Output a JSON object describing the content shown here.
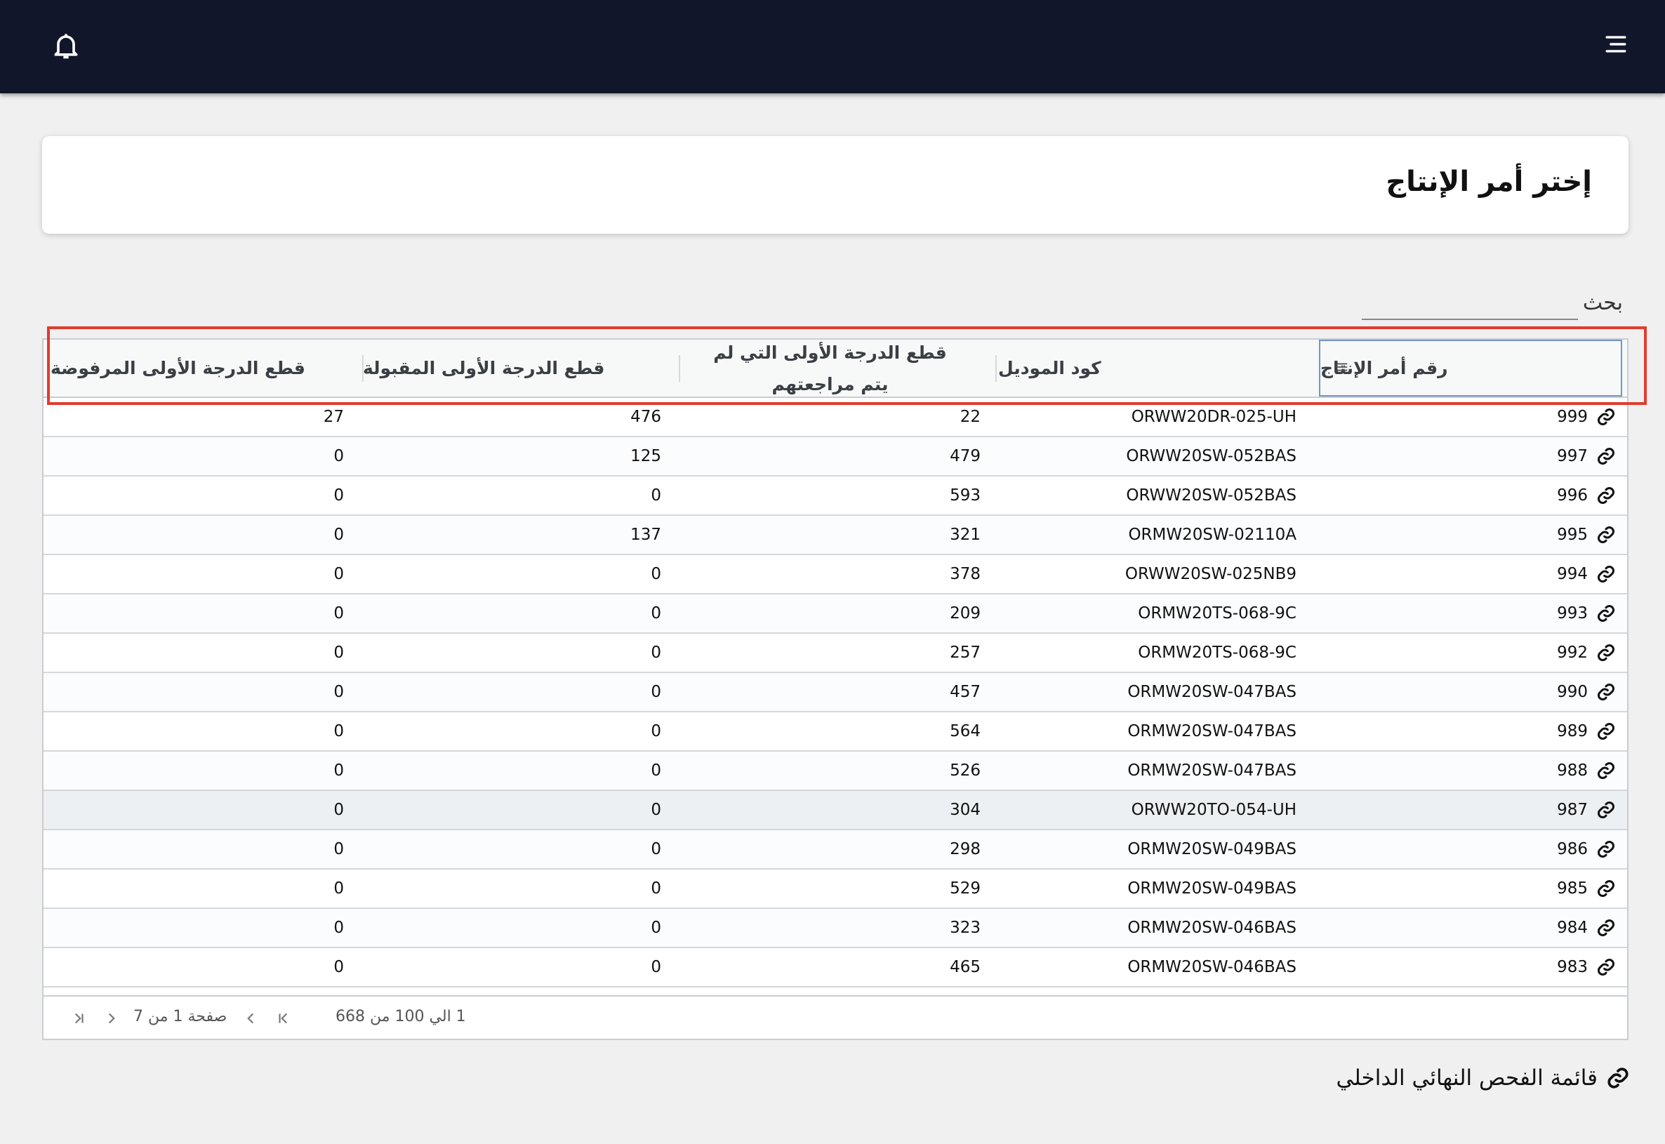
{
  "header": {
    "notifications_icon": "bell-icon",
    "menu_icon": "hamburger-menu-icon"
  },
  "page": {
    "title": "إختر أمر الإنتاج"
  },
  "search": {
    "label": "بحث",
    "value": "",
    "placeholder": ""
  },
  "table": {
    "columns": [
      {
        "label": "رقم أمر الإنتاج"
      },
      {
        "label": "كود الموديل"
      },
      {
        "label": "قطع الدرجة الأولى التي لم يتم مراجعتهم"
      },
      {
        "label": "قطع الدرجة الأولى المقبولة"
      },
      {
        "label": "قطع الدرجة الأولى المرفوضة"
      }
    ],
    "rows": [
      {
        "order": "999",
        "model": "ORWW20DR-025-UH",
        "pending": "22",
        "accepted": "476",
        "rejected": "27"
      },
      {
        "order": "997",
        "model": "ORWW20SW-052BAS",
        "pending": "479",
        "accepted": "125",
        "rejected": "0"
      },
      {
        "order": "996",
        "model": "ORWW20SW-052BAS",
        "pending": "593",
        "accepted": "0",
        "rejected": "0"
      },
      {
        "order": "995",
        "model": "ORMW20SW-02110A",
        "pending": "321",
        "accepted": "137",
        "rejected": "0"
      },
      {
        "order": "994",
        "model": "ORWW20SW-025NB9",
        "pending": "378",
        "accepted": "0",
        "rejected": "0"
      },
      {
        "order": "993",
        "model": "ORMW20TS-068-9C",
        "pending": "209",
        "accepted": "0",
        "rejected": "0"
      },
      {
        "order": "992",
        "model": "ORMW20TS-068-9C",
        "pending": "257",
        "accepted": "0",
        "rejected": "0"
      },
      {
        "order": "990",
        "model": "ORMW20SW-047BAS",
        "pending": "457",
        "accepted": "0",
        "rejected": "0"
      },
      {
        "order": "989",
        "model": "ORMW20SW-047BAS",
        "pending": "564",
        "accepted": "0",
        "rejected": "0"
      },
      {
        "order": "988",
        "model": "ORMW20SW-047BAS",
        "pending": "526",
        "accepted": "0",
        "rejected": "0"
      },
      {
        "order": "987",
        "model": "ORWW20TO-054-UH",
        "pending": "304",
        "accepted": "0",
        "rejected": "0"
      },
      {
        "order": "986",
        "model": "ORMW20SW-049BAS",
        "pending": "298",
        "accepted": "0",
        "rejected": "0"
      },
      {
        "order": "985",
        "model": "ORMW20SW-049BAS",
        "pending": "529",
        "accepted": "0",
        "rejected": "0"
      },
      {
        "order": "984",
        "model": "ORMW20SW-046BAS",
        "pending": "323",
        "accepted": "0",
        "rejected": "0"
      },
      {
        "order": "983",
        "model": "ORMW20SW-046BAS",
        "pending": "465",
        "accepted": "0",
        "rejected": "0"
      }
    ],
    "pagination": {
      "range_text": "1 الي 100 من 668",
      "page_text": "صفحة 1 من 7"
    }
  },
  "bottom_link": {
    "label": "قائمة الفحص النهائي الداخلي",
    "icon": "link-icon"
  },
  "colors": {
    "topbar": "#12162b",
    "highlight": "#e13b2e",
    "background": "#f0f0f0"
  }
}
